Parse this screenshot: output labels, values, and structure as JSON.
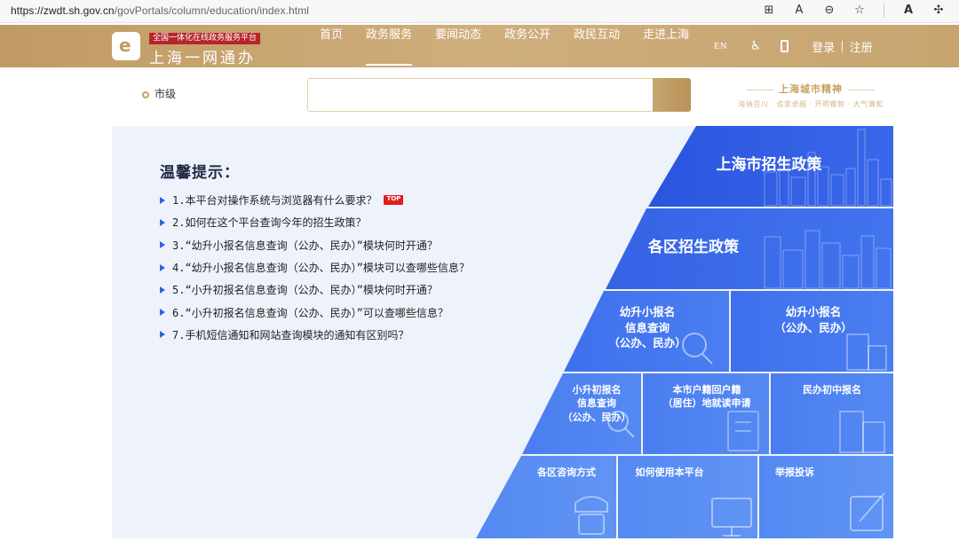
{
  "browser": {
    "url_host": "https://zwdt.sh.gov.cn",
    "url_path": "/govPortals/column/education/index.html",
    "icons": [
      "grid-icon",
      "read-aloud-icon",
      "zoom-icon",
      "favorites-icon",
      "ai-icon",
      "extensions-icon"
    ]
  },
  "header": {
    "logo_subtitle": "全国一体化在线政务服务平台",
    "logo_title": "上海一网通办",
    "nav": [
      {
        "label": "首页",
        "active": false
      },
      {
        "label": "政务服务",
        "active": true
      },
      {
        "label": "要闻动态",
        "active": false
      },
      {
        "label": "政务公开",
        "active": false
      },
      {
        "label": "政民互动",
        "active": false
      },
      {
        "label": "走进上海",
        "active": false
      }
    ],
    "lang": "EN",
    "login": "登录",
    "divider": "|",
    "register": "注册"
  },
  "search": {
    "location": "市级",
    "value": ""
  },
  "slogan": {
    "title": "上海城市精神",
    "subtitle": "海纳百川 · 追求卓越 · 开明睿智 · 大气谦和"
  },
  "tips": {
    "title": "温馨提示：",
    "top_badge": "TOP",
    "items": [
      "1.本平台对操作系统与浏览器有什么要求？",
      "2.如何在这个平台查询今年的招生政策？",
      "3.“幼升小报名信息查询（公办、民办）”模块何时开通？",
      "4.“幼升小报名信息查询（公办、民办）”模块可以查哪些信息？",
      "5.“小升初报名信息查询（公办、民办）”模块何时开通？",
      "6.“小升初报名信息查询（公办、民办）”可以查哪些信息？",
      "7.手机短信通知和网站查询模块的通知有区别吗？"
    ]
  },
  "tiles": {
    "shanghai_policy": "上海市招生政策",
    "district_policy": "各区招生政策",
    "kindergarten_query_l1": "幼升小报名",
    "kindergarten_query_l2": "信息查询",
    "kindergarten_query_l3": "（公办、民办）",
    "kindergarten_signup_l1": "幼升小报名",
    "kindergarten_signup_l2": "（公办、民办）",
    "primary_query_l1": "小升初报名",
    "primary_query_l2": "信息查询",
    "primary_query_l3": "（公办、民办）",
    "hukou_l1": "本市户籍回户籍",
    "hukou_l2": "（居住）地就读申请",
    "private_junior": "民办初中报名",
    "district_contact": "各区咨询方式",
    "how_to_use": "如何使用本平台",
    "complaint": "举报投诉"
  },
  "colors": {
    "header_gold": "#c7a470",
    "tile_blue_dark": "#2c56e0",
    "tile_blue": "#3f72ee",
    "tile_blue_light": "#5b8ef2",
    "panel_bg": "#eef2fa"
  }
}
